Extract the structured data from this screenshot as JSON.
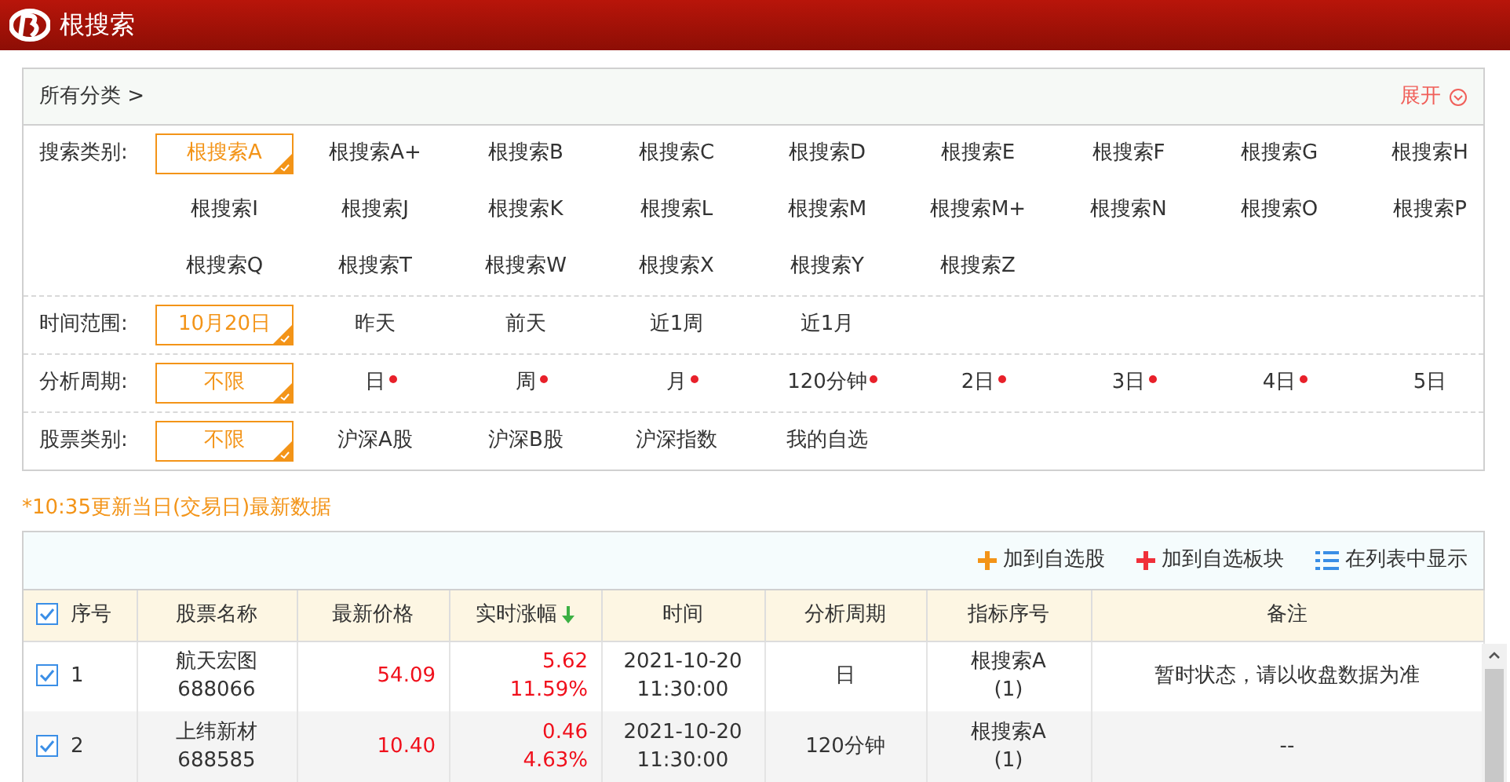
{
  "window": {
    "title": "根搜索"
  },
  "filters": {
    "breadcrumb": "所有分类 >",
    "expand": "展开",
    "groups": [
      {
        "label": "搜索类别:",
        "items": [
          {
            "text": "根搜索A",
            "selected": true,
            "dot": false
          },
          {
            "text": "根搜索A+",
            "selected": false,
            "dot": false
          },
          {
            "text": "根搜索B",
            "selected": false,
            "dot": false
          },
          {
            "text": "根搜索C",
            "selected": false,
            "dot": false
          },
          {
            "text": "根搜索D",
            "selected": false,
            "dot": false
          },
          {
            "text": "根搜索E",
            "selected": false,
            "dot": false
          },
          {
            "text": "根搜索F",
            "selected": false,
            "dot": false
          },
          {
            "text": "根搜索G",
            "selected": false,
            "dot": false
          },
          {
            "text": "根搜索H",
            "selected": false,
            "dot": false
          },
          {
            "text": "根搜索I",
            "selected": false,
            "dot": false
          },
          {
            "text": "根搜索J",
            "selected": false,
            "dot": false
          },
          {
            "text": "根搜索K",
            "selected": false,
            "dot": false
          },
          {
            "text": "根搜索L",
            "selected": false,
            "dot": false
          },
          {
            "text": "根搜索M",
            "selected": false,
            "dot": false
          },
          {
            "text": "根搜索M+",
            "selected": false,
            "dot": false
          },
          {
            "text": "根搜索N",
            "selected": false,
            "dot": false
          },
          {
            "text": "根搜索O",
            "selected": false,
            "dot": false
          },
          {
            "text": "根搜索P",
            "selected": false,
            "dot": false
          },
          {
            "text": "根搜索Q",
            "selected": false,
            "dot": false
          },
          {
            "text": "根搜索T",
            "selected": false,
            "dot": false
          },
          {
            "text": "根搜索W",
            "selected": false,
            "dot": false
          },
          {
            "text": "根搜索X",
            "selected": false,
            "dot": false
          },
          {
            "text": "根搜索Y",
            "selected": false,
            "dot": false
          },
          {
            "text": "根搜索Z",
            "selected": false,
            "dot": false
          }
        ]
      },
      {
        "label": "时间范围:",
        "items": [
          {
            "text": "10月20日",
            "selected": true,
            "dot": false
          },
          {
            "text": "昨天",
            "selected": false,
            "dot": false
          },
          {
            "text": "前天",
            "selected": false,
            "dot": false
          },
          {
            "text": "近1周",
            "selected": false,
            "dot": false
          },
          {
            "text": "近1月",
            "selected": false,
            "dot": false
          }
        ]
      },
      {
        "label": "分析周期:",
        "items": [
          {
            "text": "不限",
            "selected": true,
            "dot": false
          },
          {
            "text": "日",
            "selected": false,
            "dot": true
          },
          {
            "text": "周",
            "selected": false,
            "dot": true
          },
          {
            "text": "月",
            "selected": false,
            "dot": true
          },
          {
            "text": "120分钟",
            "selected": false,
            "dot": true
          },
          {
            "text": "2日",
            "selected": false,
            "dot": true
          },
          {
            "text": "3日",
            "selected": false,
            "dot": true
          },
          {
            "text": "4日",
            "selected": false,
            "dot": true
          },
          {
            "text": "5日",
            "selected": false,
            "dot": false
          }
        ]
      },
      {
        "label": "股票类别:",
        "items": [
          {
            "text": "不限",
            "selected": true,
            "dot": false
          },
          {
            "text": "沪深A股",
            "selected": false,
            "dot": false
          },
          {
            "text": "沪深B股",
            "selected": false,
            "dot": false
          },
          {
            "text": "沪深指数",
            "selected": false,
            "dot": false
          },
          {
            "text": "我的自选",
            "selected": false,
            "dot": false
          }
        ]
      }
    ]
  },
  "notice": "*10:35更新当日(交易日)最新数据",
  "toolbar": [
    {
      "kind": "add-stock",
      "label": "加到自选股"
    },
    {
      "kind": "add-block",
      "label": "加到自选板块"
    },
    {
      "kind": "list",
      "label": "在列表中显示"
    }
  ],
  "table": {
    "all_checked": true,
    "columns": [
      "序号",
      "股票名称",
      "最新价格",
      "实时涨幅",
      "时间",
      "分析周期",
      "指标序号",
      "备注"
    ],
    "rows": [
      {
        "checked": true,
        "index": "1",
        "name": "航天宏图",
        "code": "688066",
        "price": "54.09",
        "change": "5.62",
        "change_pct": "11.59%",
        "date": "2021-10-20",
        "time": "11:30:00",
        "period": "日",
        "indicator": "根搜索A",
        "indicator_no": "(1)",
        "note": "暂时状态，请以收盘数据为准"
      },
      {
        "checked": true,
        "index": "2",
        "name": "上纬新材",
        "code": "688585",
        "price": "10.40",
        "change": "0.46",
        "change_pct": "4.63%",
        "date": "2021-10-20",
        "time": "11:30:00",
        "period": "120分钟",
        "indicator": "根搜索A",
        "indicator_no": "(1)",
        "note": "--"
      }
    ]
  }
}
